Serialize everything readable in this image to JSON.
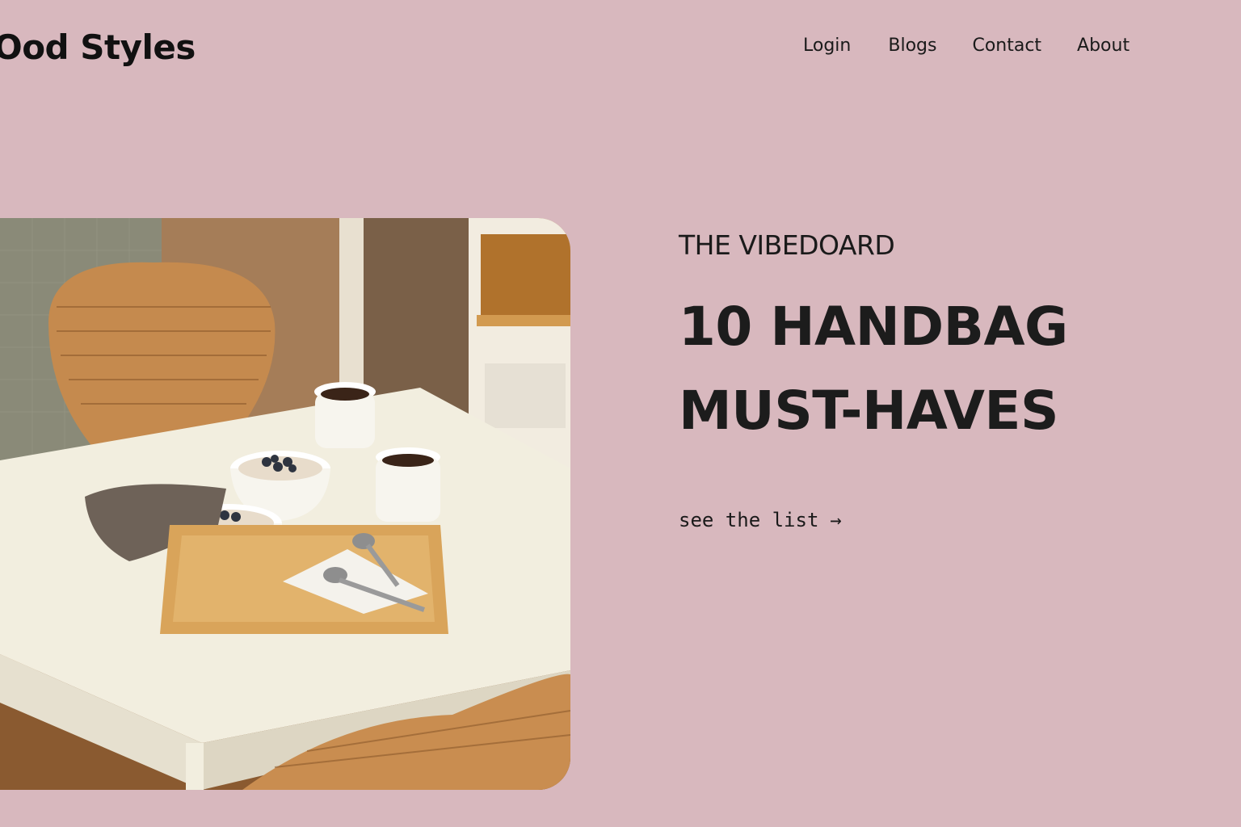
{
  "brand": {
    "name": "Ood Styles"
  },
  "nav": {
    "items": [
      {
        "label": "Login"
      },
      {
        "label": "Blogs"
      },
      {
        "label": "Contact"
      },
      {
        "label": "About"
      }
    ]
  },
  "hero": {
    "eyebrow": "THE VIBEDOARD",
    "headline_line1": "10 HANDBAG",
    "headline_line2": "MUST-HAVES",
    "cta_label": "see the list",
    "cta_arrow": "→"
  },
  "colors": {
    "background": "#d8b8be",
    "text": "#1a1a1a"
  },
  "icons": {
    "cta_arrow": "arrow-right-icon"
  }
}
